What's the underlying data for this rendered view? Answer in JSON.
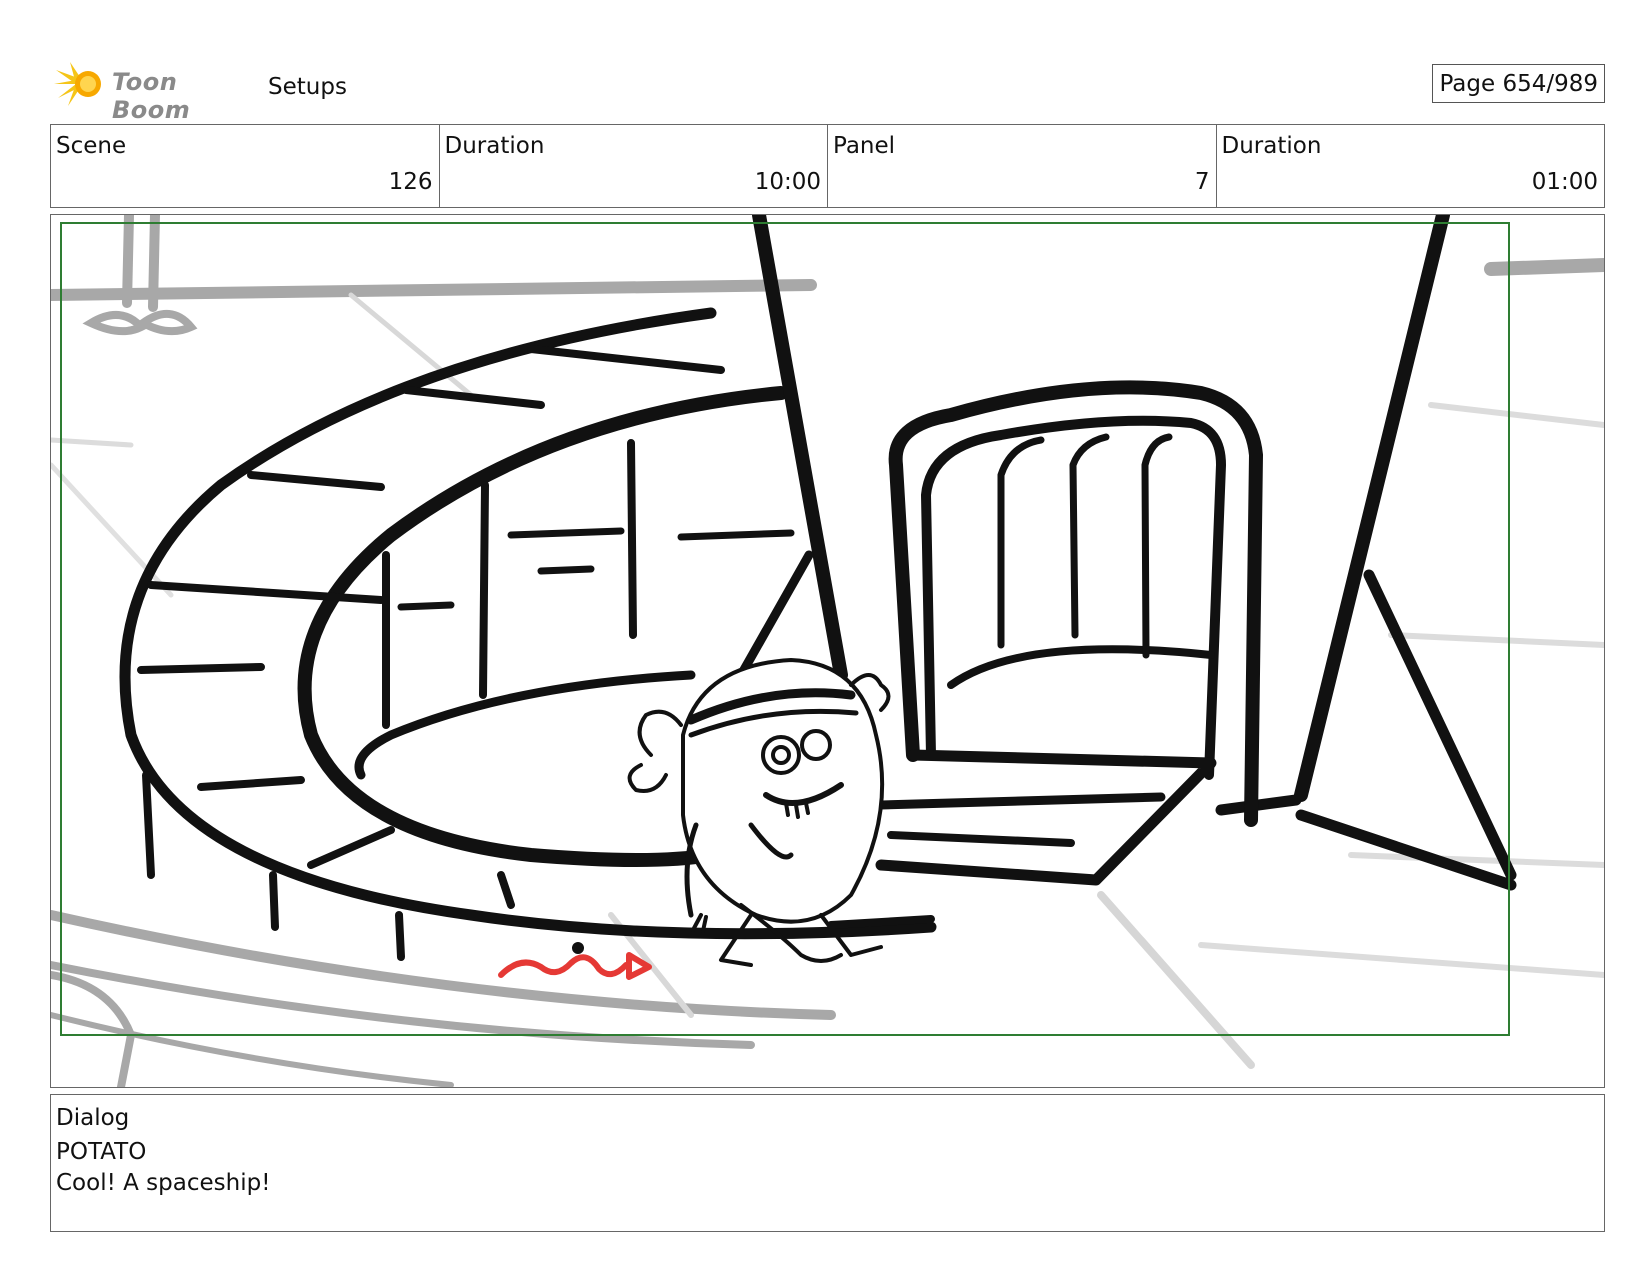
{
  "header": {
    "logo_text": "Toon Boom",
    "section_title": "Setups",
    "page_label": "Page 654/989"
  },
  "info": {
    "scene_label": "Scene",
    "scene_value": "126",
    "scene_duration_label": "Duration",
    "scene_duration_value": "10:00",
    "panel_label": "Panel",
    "panel_value": "7",
    "panel_duration_label": "Duration",
    "panel_duration_value": "01:00"
  },
  "dialog": {
    "label": "Dialog",
    "speaker": "POTATO",
    "line": "Cool! A spaceship!"
  },
  "colors": {
    "safe_frame": "#2e7d32",
    "sketch": "#111111",
    "background_sketch": "#9e9e9e",
    "motion_arrow": "#e53935",
    "logo_gold": "#f5c518"
  }
}
